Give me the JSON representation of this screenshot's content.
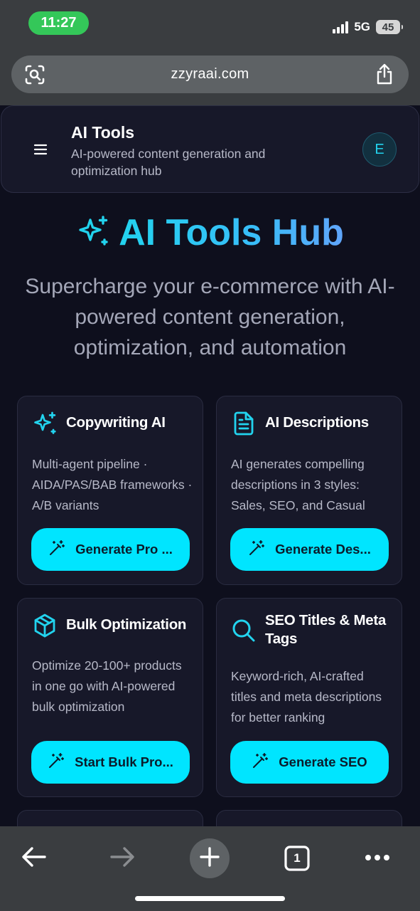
{
  "status_bar": {
    "time": "11:27",
    "network": "5G",
    "battery": "45"
  },
  "browser": {
    "url": "zzyraai.com",
    "lens_icon": "camera-search-icon",
    "share_icon": "share-icon",
    "toolbar": {
      "back_icon": "back-arrow-icon",
      "forward_icon": "forward-arrow-icon",
      "new_tab_icon": "plus-icon",
      "tab_count": "1",
      "more_icon": "more-dots-icon"
    }
  },
  "header": {
    "title": "AI Tools",
    "subtitle": "AI-powered content generation and optimization hub",
    "avatar_initial": "E",
    "menu_icon": "hamburger-menu-icon"
  },
  "hero": {
    "title": "AI Tools Hub",
    "subtitle": "Supercharge your e-commerce with AI-powered content generation, optimization, and automation",
    "icon": "sparkles-icon"
  },
  "cards": [
    {
      "title": "Copywriting AI",
      "icon": "sparkles-icon",
      "description": "Multi-agent pipeline · AIDA/PAS/BAB frameworks · A/B variants",
      "button": "Generate Pro ..."
    },
    {
      "title": "AI Descriptions",
      "icon": "document-icon",
      "description": "AI generates compelling descriptions in 3 styles: Sales, SEO, and Casual",
      "button": "Generate Des..."
    },
    {
      "title": "Bulk Optimization",
      "icon": "box-icon",
      "description": "Optimize 20-100+ products in one go with AI-powered bulk optimization",
      "button": "Start Bulk Pro..."
    },
    {
      "title": "SEO Titles & Meta Tags",
      "icon": "search-icon",
      "description": "Keyword-rich, AI-crafted titles and meta descriptions for better ranking",
      "button": "Generate SEO"
    }
  ],
  "colors": {
    "accent": "#00e5ff",
    "background": "#0e0f1d",
    "card": "#171829",
    "chrome": "#3a3d40"
  }
}
